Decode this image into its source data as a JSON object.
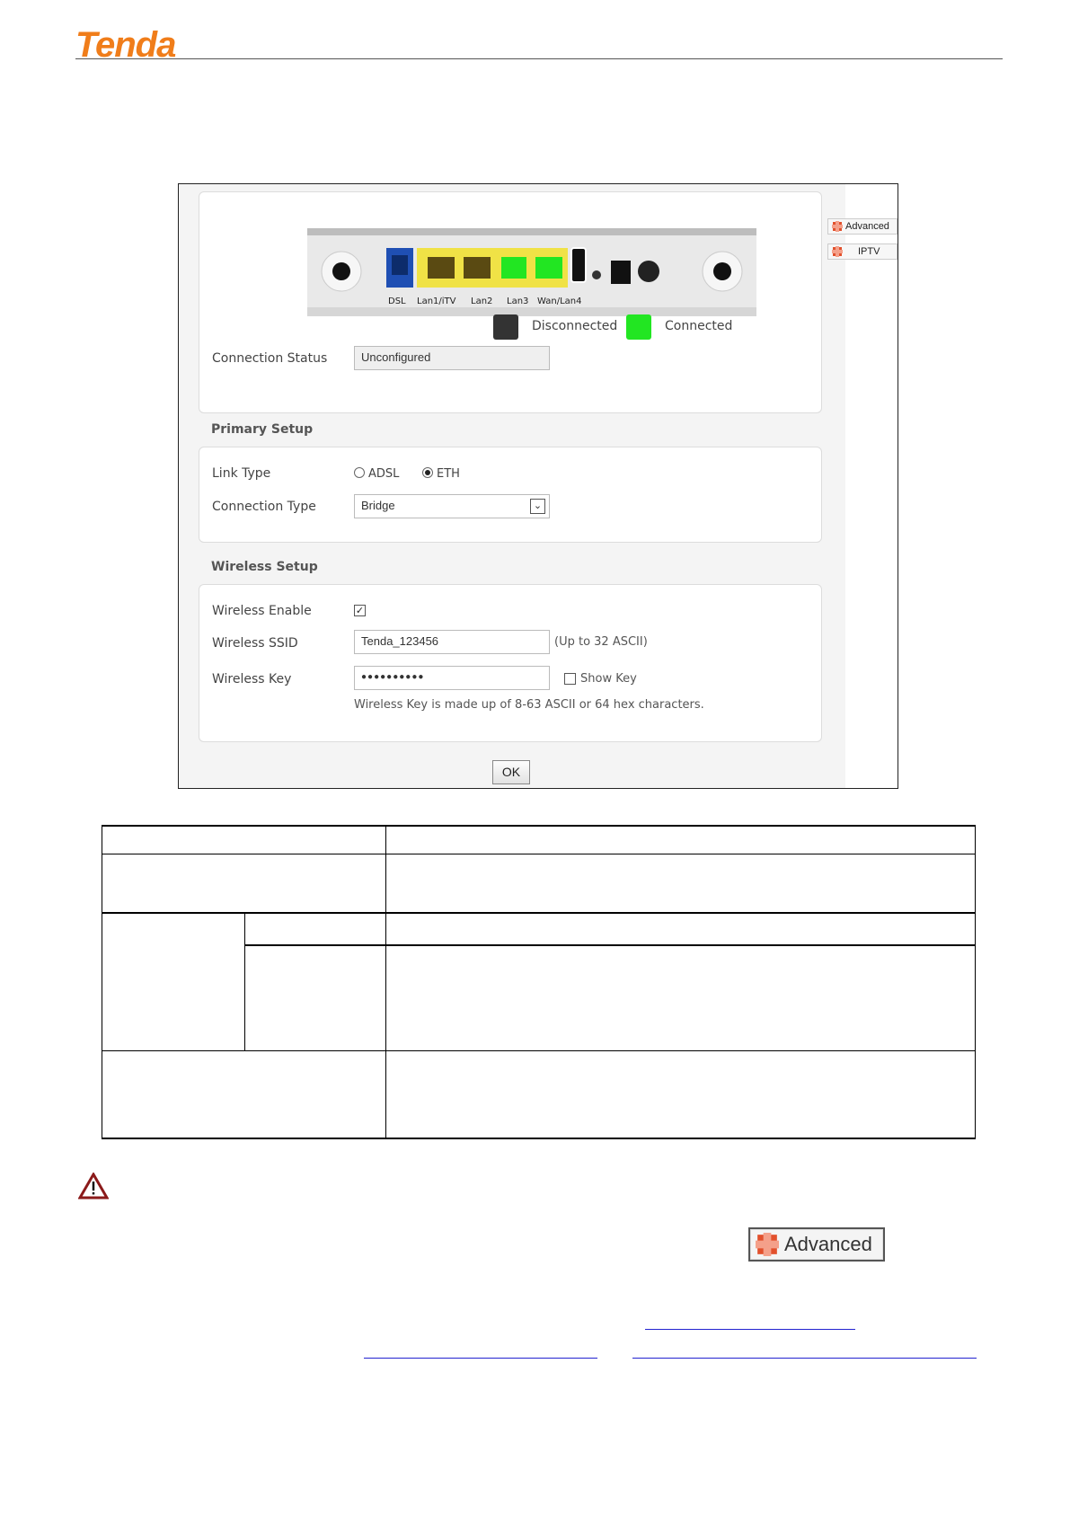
{
  "header": {
    "logo": "Tenda"
  },
  "screenshot": {
    "router": {
      "ports": [
        "DSL",
        "Lan1/iTV",
        "Lan2",
        "Lan3",
        "Wan/Lan4"
      ]
    },
    "legend": {
      "disconnected": "Disconnected",
      "connected": "Connected",
      "disconnected_color": "#222222",
      "connected_color": "#22e622"
    },
    "status": {
      "label": "Connection Status",
      "value": "Unconfigured"
    },
    "primary": {
      "title": "Primary Setup",
      "link_type_label": "Link Type",
      "adsl": "ADSL",
      "eth": "ETH",
      "selected": "ETH",
      "connection_type_label": "Connection Type",
      "connection_type_value": "Bridge"
    },
    "wireless": {
      "title": "Wireless Setup",
      "enable_label": "Wireless Enable",
      "enable_checked": true,
      "ssid_label": "Wireless SSID",
      "ssid_value": "Tenda_123456",
      "ssid_hint": "(Up to 32 ASCII)",
      "key_label": "Wireless Key",
      "key_value": "●●●●●●●●●●",
      "show_key": "Show Key",
      "key_hint": "Wireless Key is made up of 8-63 ASCII or 64 hex characters."
    },
    "side": {
      "advanced": "Advanced",
      "iptv": "IPTV"
    },
    "ok": "OK"
  },
  "note": {
    "advanced_button": "Advanced"
  }
}
